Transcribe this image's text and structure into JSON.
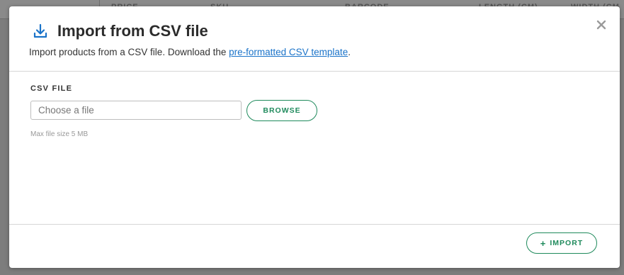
{
  "background": {
    "columns": [
      "PRICE",
      "SKU",
      "BARCODE",
      "LENGTH (CM)",
      "WIDTH (CM"
    ]
  },
  "dialog": {
    "title": "Import from CSV file",
    "subtitle_prefix": "Import products from a CSV file. Download the ",
    "subtitle_link": "pre-formatted CSV template",
    "subtitle_suffix": ".",
    "icons": {
      "title": "download-icon",
      "close": "close-icon"
    },
    "field": {
      "label": "CSV FILE",
      "placeholder": "Choose a file",
      "value": "",
      "browse_label": "BROWSE",
      "hint": "Max file size 5 MB"
    },
    "footer": {
      "import_label": "IMPORT",
      "import_icon": "plus-icon"
    }
  },
  "colors": {
    "accent_green": "#1f8a5c",
    "link_blue": "#1a73c9",
    "overlay": "#7d7d7d"
  }
}
